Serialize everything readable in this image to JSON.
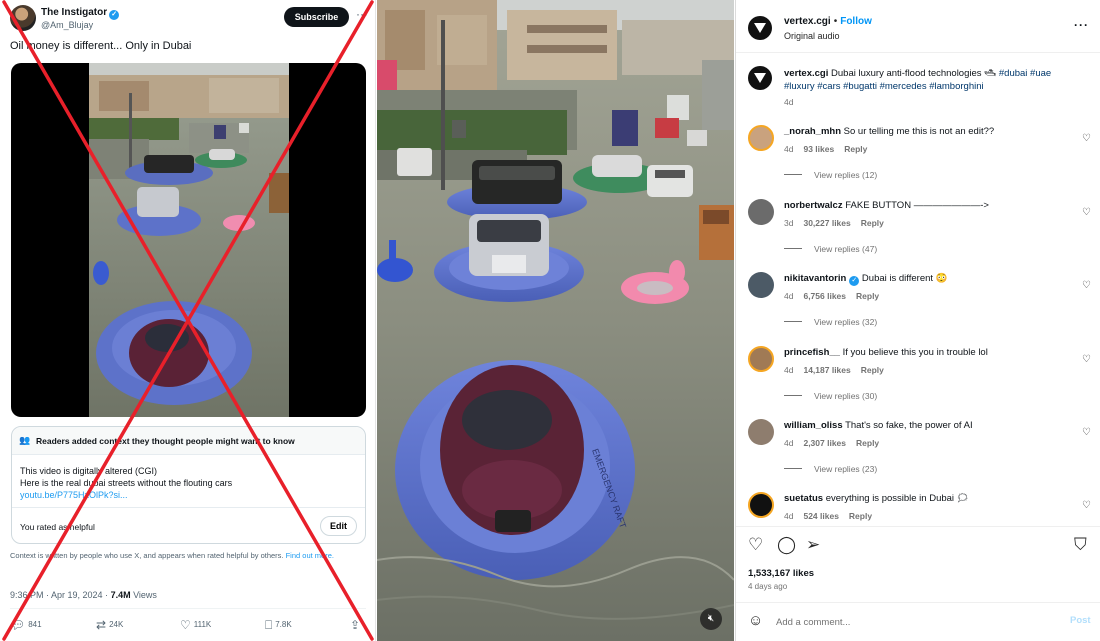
{
  "tweet": {
    "name": "The Instigator",
    "handle": "@Am_Blujay",
    "subscribe_label": "Subscribe",
    "more_icon": "···",
    "text": "Oil money is different... Only in Dubai",
    "note_title": "Readers added context they thought people might want to know",
    "note_line1": "This video is digitally altered (CGI)",
    "note_line2": "Here is the real dubai streets without the flouting cars",
    "note_link": "youtu.be/P775HxOlPk?si...",
    "rated_text": "You rated as helpful",
    "edit_label": "Edit",
    "context_text": "Context is written by people who use X, and appears when rated helpful by others.",
    "context_link": "Find out more.",
    "time": "9:36 PM · Apr 19, 2024 · ",
    "views_count": "7.4M",
    "views_label": " Views",
    "replies": "841",
    "reposts": "24K",
    "likes": "111K",
    "bookmarks": "7.8K"
  },
  "instagram": {
    "username": "vertex.cgi",
    "dot": "•",
    "follow_label": "Follow",
    "audio": "Original audio",
    "more_icon": "···",
    "caption_user": "vertex.cgi",
    "caption_text": " Dubai luxury anti-flood technologies 🛥 ",
    "caption_tags": "#dubai #uae #luxury #cars #bugatti #mercedes #lamborghini",
    "caption_time": "4d",
    "comments": [
      {
        "user": "_norah_mhn",
        "text": " So ur telling me this is not an edit??",
        "time": "4d",
        "likes": "93 likes",
        "reply": "Reply",
        "replies": "View replies (12)",
        "avatar_color": "#c9a27e"
      },
      {
        "user": "norbertwalcz",
        "text": " FAKE BUTTON ———————->",
        "time": "3d",
        "likes": "30,227 likes",
        "reply": "Reply",
        "replies": "View replies (47)",
        "avatar_color": "#6b6b6b"
      },
      {
        "user": "nikitavantorin",
        "text": " Dubai is different 😳",
        "time": "4d",
        "likes": "6,756 likes",
        "reply": "Reply",
        "replies": "View replies (32)",
        "avatar_color": "#4c5a66"
      },
      {
        "user": "princefish__",
        "text": " If you believe this you in trouble lol",
        "time": "4d",
        "likes": "14,187 likes",
        "reply": "Reply",
        "replies": "View replies (30)",
        "avatar_color": "#a07a55"
      },
      {
        "user": "william_oliss",
        "text": " That's so fake, the power of AI",
        "time": "4d",
        "likes": "2,307 likes",
        "reply": "Reply",
        "replies": "View replies (23)",
        "avatar_color": "#8e7d6e"
      },
      {
        "user": "suetatus",
        "text": " everything is possible in Dubai 🗯",
        "time": "4d",
        "likes": "524 likes",
        "reply": "Reply",
        "replies": "",
        "avatar_color": "#111111"
      }
    ],
    "likes": "1,533,167 likes",
    "date": "4 days ago",
    "add_comment_placeholder": "Add a comment...",
    "post_label": "Post"
  }
}
